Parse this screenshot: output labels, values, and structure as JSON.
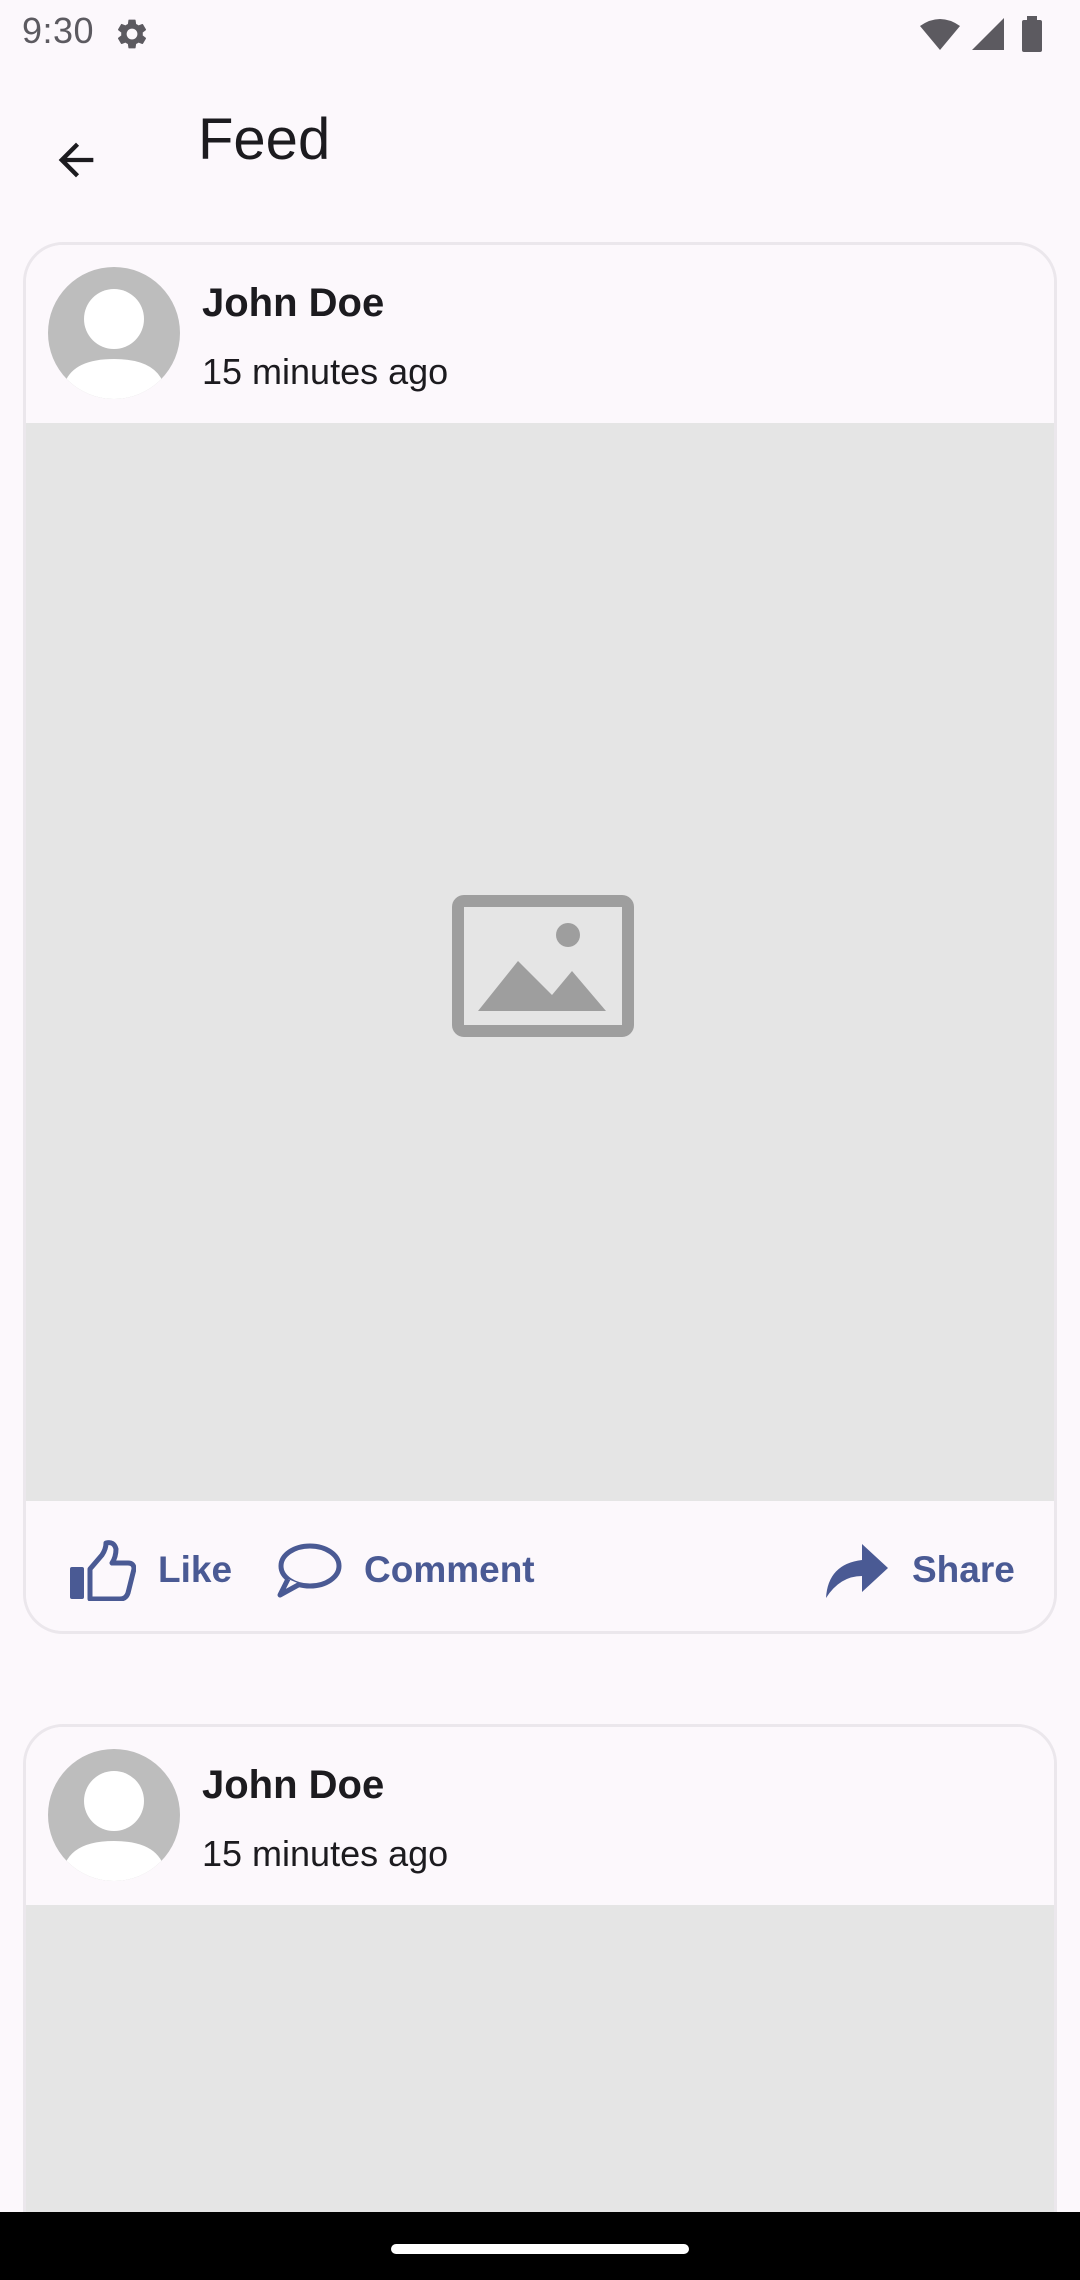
{
  "status_bar": {
    "time": "9:30",
    "icons": [
      "gear-icon",
      "wifi-icon",
      "signal-icon",
      "battery-icon"
    ]
  },
  "app_bar": {
    "title": "Feed",
    "back_icon": "arrow-back-icon"
  },
  "posts": [
    {
      "author": "John Doe",
      "time": "15 minutes ago",
      "image": "image-placeholder-icon",
      "actions": {
        "like": "Like",
        "comment": "Comment",
        "share": "Share"
      }
    },
    {
      "author": "John Doe",
      "time": "15 minutes ago",
      "image": "image-placeholder-icon"
    }
  ],
  "colors": {
    "background": "#fcf8fc",
    "card_border": "#ebe7ec",
    "image_bg": "#e5e5e5",
    "action_accent": "#4a5a94",
    "avatar": "#bdbdbd"
  }
}
